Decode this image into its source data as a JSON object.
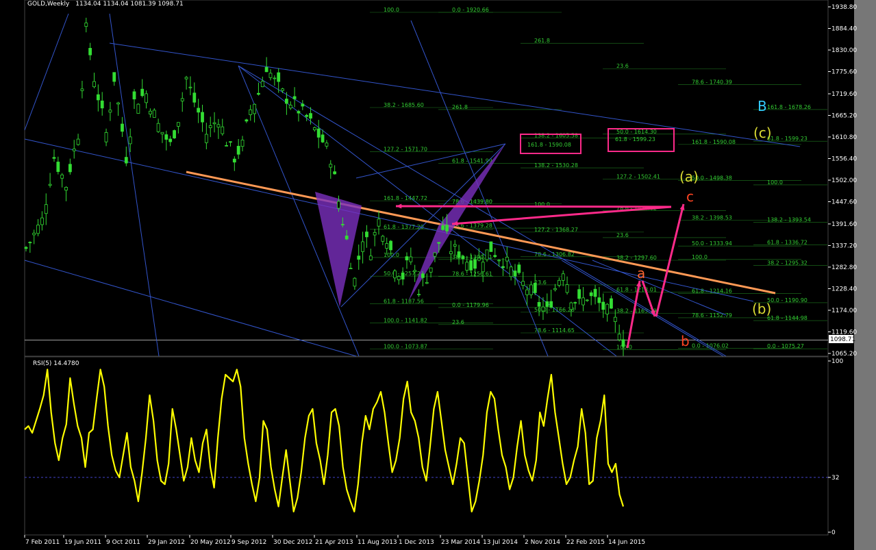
{
  "header": {
    "symbol": "GOLD,Weekly",
    "ohlc": "1134.04 1134.04 1081.39 1098.71"
  },
  "current_price": "1098.71",
  "colors": {
    "background": "#000000",
    "candle": "#33dd33",
    "grid": "#1f7a1f",
    "trend": "#3355cc",
    "orange_line": "#ff9955",
    "pattern": "#7b2fbe",
    "arrows": "#ff2a8a",
    "rsi": "#ffff00"
  },
  "chart_data": [
    {
      "type": "candlestick",
      "series_name": "GOLD,Weekly",
      "price_axis": {
        "ticks": [
          "1938.80",
          "1884.40",
          "1830.00",
          "1775.60",
          "1719.60",
          "1665.20",
          "1610.80",
          "1556.40",
          "1502.00",
          "1447.60",
          "1391.60",
          "1337.20",
          "1282.80",
          "1228.40",
          "1174.00",
          "1119.60",
          "1065.20"
        ],
        "range": [
          1060,
          1945
        ]
      },
      "x_labels": [
        "7 Feb 2011",
        "19 Jun 2011",
        "9 Oct 2011",
        "29 Jan 2012",
        "20 May 2012",
        "9 Sep 2012",
        "30 Dec 2012",
        "21 Apr 2013",
        "11 Aug 2013",
        "1 Dec 2013",
        "23 Mar 2014",
        "13 Jul 2014",
        "2 Nov 2014",
        "22 Feb 2015",
        "14 Jun 2015"
      ],
      "close_path": [
        [
          0,
          1330
        ],
        [
          4,
          1400
        ],
        [
          7,
          1560
        ],
        [
          10,
          1490
        ],
        [
          13,
          1620
        ],
        [
          15,
          1880
        ],
        [
          17,
          1760
        ],
        [
          20,
          1620
        ],
        [
          22,
          1760
        ],
        [
          25,
          1560
        ],
        [
          27,
          1700
        ],
        [
          30,
          1720
        ],
        [
          33,
          1640
        ],
        [
          36,
          1590
        ],
        [
          38,
          1660
        ],
        [
          40,
          1760
        ],
        [
          42,
          1700
        ],
        [
          45,
          1620
        ],
        [
          48,
          1660
        ],
        [
          50,
          1600
        ],
        [
          52,
          1560
        ],
        [
          54,
          1590
        ],
        [
          56,
          1680
        ],
        [
          58,
          1720
        ],
        [
          60,
          1790
        ],
        [
          62,
          1750
        ],
        [
          64,
          1720
        ],
        [
          66,
          1700
        ],
        [
          68,
          1680
        ],
        [
          70,
          1660
        ],
        [
          72,
          1630
        ],
        [
          74,
          1600
        ],
        [
          76,
          1560
        ],
        [
          78,
          1450
        ],
        [
          80,
          1350
        ],
        [
          82,
          1250
        ],
        [
          84,
          1360
        ],
        [
          86,
          1330
        ],
        [
          88,
          1400
        ],
        [
          90,
          1360
        ],
        [
          92,
          1290
        ],
        [
          94,
          1260
        ],
        [
          96,
          1310
        ],
        [
          98,
          1230
        ],
        [
          100,
          1260
        ],
        [
          102,
          1310
        ],
        [
          104,
          1380
        ],
        [
          106,
          1330
        ],
        [
          108,
          1320
        ],
        [
          110,
          1300
        ],
        [
          112,
          1290
        ],
        [
          114,
          1310
        ],
        [
          116,
          1330
        ],
        [
          118,
          1310
        ],
        [
          120,
          1290
        ],
        [
          122,
          1260
        ],
        [
          124,
          1240
        ],
        [
          126,
          1220
        ],
        [
          128,
          1190
        ],
        [
          130,
          1170
        ],
        [
          132,
          1230
        ],
        [
          134,
          1280
        ],
        [
          136,
          1210
        ],
        [
          138,
          1190
        ],
        [
          140,
          1210
        ],
        [
          142,
          1200
        ],
        [
          144,
          1180
        ],
        [
          146,
          1160
        ],
        [
          148,
          1130
        ],
        [
          149,
          1098
        ]
      ],
      "fib_levels": [
        {
          "label": "100.0",
          "price": 1925
        },
        {
          "label": "0.0 - 1920.66",
          "price": 1925
        },
        {
          "label": "261.8",
          "price": 1847
        },
        {
          "label": "23.6",
          "price": 1783
        },
        {
          "label": "78.6 - 1740.39",
          "price": 1743
        },
        {
          "label": "161.8 - 1678.26",
          "price": 1680
        },
        {
          "label": "38.2 - 1685.60",
          "price": 1685
        },
        {
          "label": "261.8",
          "price": 1680
        },
        {
          "label": "138.2 - 1605.58",
          "price": 1608
        },
        {
          "label": "50.0 - 1614.30",
          "price": 1618
        },
        {
          "label": "161.8 - 1590.08",
          "price": 1592
        },
        {
          "label": "61.8 - 1599.23",
          "price": 1600
        },
        {
          "label": "127.2 - 1571.70",
          "price": 1574
        },
        {
          "label": "61.8 - 1541.99",
          "price": 1544
        },
        {
          "label": "138.2 - 1530.28",
          "price": 1533
        },
        {
          "label": "127.2 - 1502.41",
          "price": 1505
        },
        {
          "label": "50.0 - 1498.38",
          "price": 1501
        },
        {
          "label": "100.0",
          "price": 1490
        },
        {
          "label": "161.8 - 1447.72",
          "price": 1450
        },
        {
          "label": "78.6 - 1439.80",
          "price": 1442
        },
        {
          "label": "100.0",
          "price": 1435
        },
        {
          "label": "78.6 - 1424.62",
          "price": 1425
        },
        {
          "label": "38.2 - 1398.53",
          "price": 1401
        },
        {
          "label": "138.2 - 1393.54",
          "price": 1396
        },
        {
          "label": "61.8 - 1377.20",
          "price": 1378
        },
        {
          "label": "78.6 - 1379.28",
          "price": 1381
        },
        {
          "label": "127.2 - 1368.27",
          "price": 1371
        },
        {
          "label": "23.6",
          "price": 1357
        },
        {
          "label": "50.0 - 1333.94",
          "price": 1336
        },
        {
          "label": "61.8 - 1336.72",
          "price": 1339
        },
        {
          "label": "100.0",
          "price": 1307
        },
        {
          "label": "38.2 - 1300.31",
          "price": 1302
        },
        {
          "label": "78.6 - 1306.82",
          "price": 1309
        },
        {
          "label": "38.2 - 1297.60",
          "price": 1300
        },
        {
          "label": "100.0",
          "price": 1302
        },
        {
          "label": "38.2 - 1295.32",
          "price": 1287
        },
        {
          "label": "50.0 - 1257.23",
          "price": 1260
        },
        {
          "label": "78.6 - 1256.61",
          "price": 1259
        },
        {
          "label": "23.6",
          "price": 1238
        },
        {
          "label": "61.8 - 1218.01",
          "price": 1220
        },
        {
          "label": "61.8 - 1214.16",
          "price": 1216
        },
        {
          "label": "50.0 - 1190.90",
          "price": 1193
        },
        {
          "label": "61.8 - 1187.56",
          "price": 1190
        },
        {
          "label": "0.0 - 1179.96",
          "price": 1181
        },
        {
          "label": "50.0 - 1166.28",
          "price": 1169
        },
        {
          "label": "38.2 - 1163.79",
          "price": 1166
        },
        {
          "label": "78.6 - 1152.79",
          "price": 1155
        },
        {
          "label": "61.8 - 1144.98",
          "price": 1148
        },
        {
          "label": "100.0 - 1141.82",
          "price": 1142
        },
        {
          "label": "23.6",
          "price": 1138
        },
        {
          "label": "78.6 - 1114.65",
          "price": 1117
        },
        {
          "label": "100.0",
          "price": 1075
        },
        {
          "label": "0.0 - 1076.02",
          "price": 1078
        },
        {
          "label": "0.0 - 1075.27",
          "price": 1077
        },
        {
          "label": "100.0 - 1073.87",
          "price": 1076
        }
      ],
      "wave_labels": [
        {
          "text": "B",
          "color": "#33ccff"
        },
        {
          "text": "(c)",
          "color": "#dddd33"
        },
        {
          "text": "(a)",
          "color": "#dddd33"
        },
        {
          "text": "c",
          "color": "#ff4422"
        },
        {
          "text": "a",
          "color": "#ff6633"
        },
        {
          "text": "(b)",
          "color": "#dddd33"
        },
        {
          "text": "b",
          "color": "#ff4422"
        }
      ],
      "boxes": [
        "161.8 - 1590.08",
        "61.8 - 1599.23"
      ]
    },
    {
      "type": "line",
      "series_name": "RSI(5) 14.4780",
      "ylim": [
        0,
        100
      ],
      "axis_ticks": [
        "100",
        "32",
        "0"
      ],
      "reference_level": 32,
      "values": [
        60,
        62,
        58,
        65,
        72,
        80,
        95,
        70,
        52,
        42,
        55,
        63,
        90,
        75,
        62,
        55,
        38,
        58,
        60,
        78,
        95,
        85,
        62,
        45,
        36,
        32,
        45,
        58,
        38,
        30,
        18,
        35,
        55,
        80,
        65,
        42,
        30,
        28,
        40,
        72,
        60,
        45,
        30,
        38,
        55,
        42,
        35,
        52,
        60,
        38,
        26,
        55,
        78,
        92,
        90,
        88,
        95,
        85,
        55,
        40,
        28,
        18,
        32,
        65,
        60,
        38,
        25,
        15,
        32,
        48,
        30,
        12,
        20,
        35,
        55,
        68,
        72,
        52,
        42,
        28,
        45,
        70,
        72,
        62,
        38,
        25,
        18,
        12,
        28,
        52,
        68,
        60,
        72,
        76,
        82,
        70,
        52,
        35,
        42,
        55,
        78,
        88,
        70,
        65,
        55,
        38,
        30,
        50,
        72,
        82,
        65,
        48,
        38,
        28,
        40,
        55,
        52,
        32,
        12,
        18,
        30,
        45,
        70,
        82,
        78,
        60,
        45,
        38,
        25,
        32,
        50,
        65,
        45,
        36,
        30,
        42,
        70,
        62,
        78,
        92,
        70,
        55,
        40,
        28,
        32,
        42,
        50,
        72,
        58,
        28,
        30,
        55,
        65,
        80,
        40,
        35,
        40,
        22,
        15
      ]
    }
  ]
}
